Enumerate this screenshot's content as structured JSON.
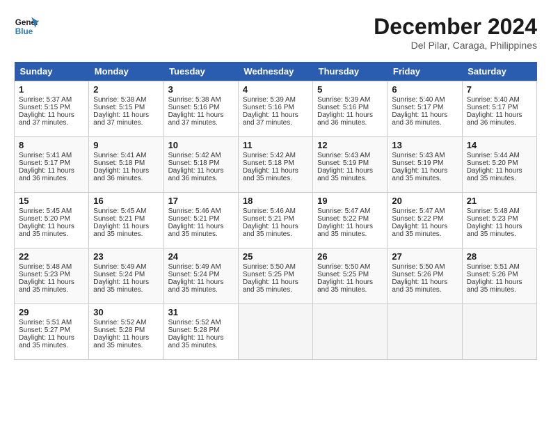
{
  "header": {
    "logo_line1": "General",
    "logo_line2": "Blue",
    "month_year": "December 2024",
    "location": "Del Pilar, Caraga, Philippines"
  },
  "days_of_week": [
    "Sunday",
    "Monday",
    "Tuesday",
    "Wednesday",
    "Thursday",
    "Friday",
    "Saturday"
  ],
  "weeks": [
    {
      "row_class": "row-odd",
      "days": [
        {
          "num": "1",
          "sunrise": "5:37 AM",
          "sunset": "5:15 PM",
          "daylight": "11 hours and 37 minutes."
        },
        {
          "num": "2",
          "sunrise": "5:38 AM",
          "sunset": "5:15 PM",
          "daylight": "11 hours and 37 minutes."
        },
        {
          "num": "3",
          "sunrise": "5:38 AM",
          "sunset": "5:16 PM",
          "daylight": "11 hours and 37 minutes."
        },
        {
          "num": "4",
          "sunrise": "5:39 AM",
          "sunset": "5:16 PM",
          "daylight": "11 hours and 37 minutes."
        },
        {
          "num": "5",
          "sunrise": "5:39 AM",
          "sunset": "5:16 PM",
          "daylight": "11 hours and 36 minutes."
        },
        {
          "num": "6",
          "sunrise": "5:40 AM",
          "sunset": "5:17 PM",
          "daylight": "11 hours and 36 minutes."
        },
        {
          "num": "7",
          "sunrise": "5:40 AM",
          "sunset": "5:17 PM",
          "daylight": "11 hours and 36 minutes."
        }
      ]
    },
    {
      "row_class": "row-even",
      "days": [
        {
          "num": "8",
          "sunrise": "5:41 AM",
          "sunset": "5:17 PM",
          "daylight": "11 hours and 36 minutes."
        },
        {
          "num": "9",
          "sunrise": "5:41 AM",
          "sunset": "5:18 PM",
          "daylight": "11 hours and 36 minutes."
        },
        {
          "num": "10",
          "sunrise": "5:42 AM",
          "sunset": "5:18 PM",
          "daylight": "11 hours and 36 minutes."
        },
        {
          "num": "11",
          "sunrise": "5:42 AM",
          "sunset": "5:18 PM",
          "daylight": "11 hours and 35 minutes."
        },
        {
          "num": "12",
          "sunrise": "5:43 AM",
          "sunset": "5:19 PM",
          "daylight": "11 hours and 35 minutes."
        },
        {
          "num": "13",
          "sunrise": "5:43 AM",
          "sunset": "5:19 PM",
          "daylight": "11 hours and 35 minutes."
        },
        {
          "num": "14",
          "sunrise": "5:44 AM",
          "sunset": "5:20 PM",
          "daylight": "11 hours and 35 minutes."
        }
      ]
    },
    {
      "row_class": "row-odd",
      "days": [
        {
          "num": "15",
          "sunrise": "5:45 AM",
          "sunset": "5:20 PM",
          "daylight": "11 hours and 35 minutes."
        },
        {
          "num": "16",
          "sunrise": "5:45 AM",
          "sunset": "5:21 PM",
          "daylight": "11 hours and 35 minutes."
        },
        {
          "num": "17",
          "sunrise": "5:46 AM",
          "sunset": "5:21 PM",
          "daylight": "11 hours and 35 minutes."
        },
        {
          "num": "18",
          "sunrise": "5:46 AM",
          "sunset": "5:21 PM",
          "daylight": "11 hours and 35 minutes."
        },
        {
          "num": "19",
          "sunrise": "5:47 AM",
          "sunset": "5:22 PM",
          "daylight": "11 hours and 35 minutes."
        },
        {
          "num": "20",
          "sunrise": "5:47 AM",
          "sunset": "5:22 PM",
          "daylight": "11 hours and 35 minutes."
        },
        {
          "num": "21",
          "sunrise": "5:48 AM",
          "sunset": "5:23 PM",
          "daylight": "11 hours and 35 minutes."
        }
      ]
    },
    {
      "row_class": "row-even",
      "days": [
        {
          "num": "22",
          "sunrise": "5:48 AM",
          "sunset": "5:23 PM",
          "daylight": "11 hours and 35 minutes."
        },
        {
          "num": "23",
          "sunrise": "5:49 AM",
          "sunset": "5:24 PM",
          "daylight": "11 hours and 35 minutes."
        },
        {
          "num": "24",
          "sunrise": "5:49 AM",
          "sunset": "5:24 PM",
          "daylight": "11 hours and 35 minutes."
        },
        {
          "num": "25",
          "sunrise": "5:50 AM",
          "sunset": "5:25 PM",
          "daylight": "11 hours and 35 minutes."
        },
        {
          "num": "26",
          "sunrise": "5:50 AM",
          "sunset": "5:25 PM",
          "daylight": "11 hours and 35 minutes."
        },
        {
          "num": "27",
          "sunrise": "5:50 AM",
          "sunset": "5:26 PM",
          "daylight": "11 hours and 35 minutes."
        },
        {
          "num": "28",
          "sunrise": "5:51 AM",
          "sunset": "5:26 PM",
          "daylight": "11 hours and 35 minutes."
        }
      ]
    },
    {
      "row_class": "row-odd",
      "days": [
        {
          "num": "29",
          "sunrise": "5:51 AM",
          "sunset": "5:27 PM",
          "daylight": "11 hours and 35 minutes."
        },
        {
          "num": "30",
          "sunrise": "5:52 AM",
          "sunset": "5:28 PM",
          "daylight": "11 hours and 35 minutes."
        },
        {
          "num": "31",
          "sunrise": "5:52 AM",
          "sunset": "5:28 PM",
          "daylight": "11 hours and 35 minutes."
        },
        null,
        null,
        null,
        null
      ]
    }
  ]
}
